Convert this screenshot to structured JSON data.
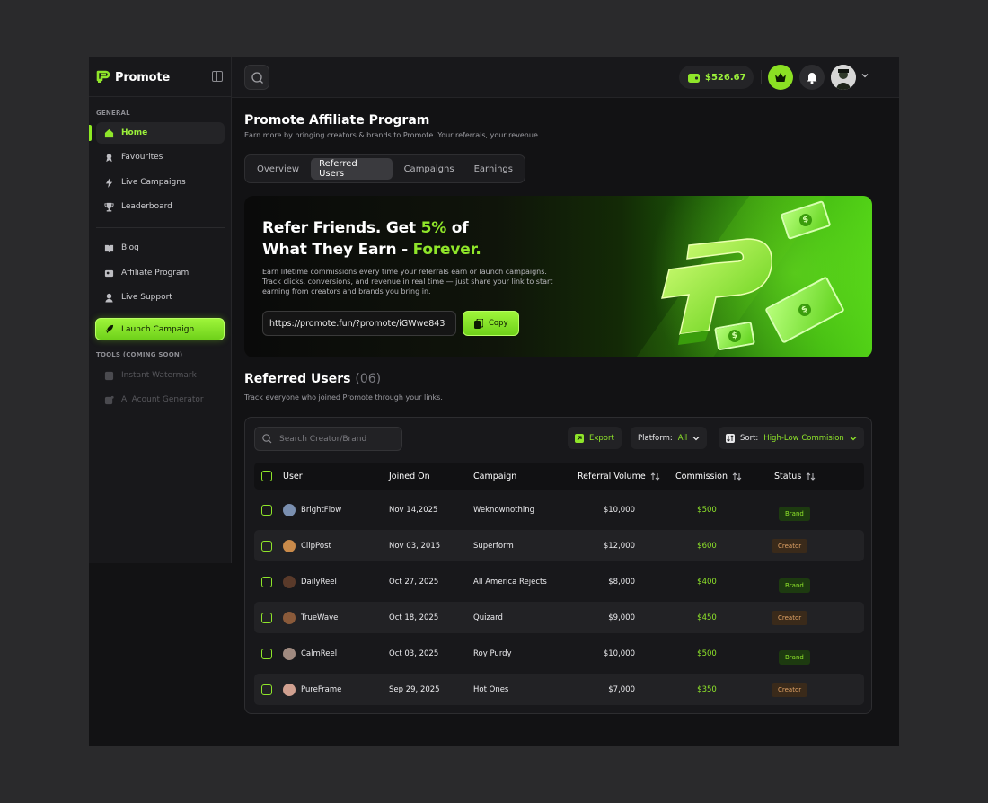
{
  "brand": {
    "name": "Promote"
  },
  "sidebar": {
    "general_label": "GENERAL",
    "items": [
      {
        "label": "Home",
        "icon": "home-icon",
        "active": true
      },
      {
        "label": "Favourites",
        "icon": "favourites-icon"
      },
      {
        "label": "Live Campaigns",
        "icon": "lightning-icon"
      },
      {
        "label": "Leaderboard",
        "icon": "trophy-icon"
      },
      {
        "label": "Blog",
        "icon": "book-icon"
      },
      {
        "label": "Affiliate Program",
        "icon": "affiliate-icon"
      },
      {
        "label": "Live Support",
        "icon": "support-icon"
      }
    ],
    "launch_label": "Launch Campaign",
    "tools_label": "TOOLS (COMING SOON)",
    "tools": [
      {
        "label": "Instant Watermark",
        "icon": "watermark-icon"
      },
      {
        "label": "AI Acount Generator",
        "icon": "ai-icon"
      }
    ]
  },
  "topbar": {
    "balance": "$526.67"
  },
  "page": {
    "title": "Promote Affiliate Program",
    "subtitle": "Earn more by bringing creators & brands to Promote. Your referrals, your revenue.",
    "tabs": [
      "Overview",
      "Referred Users",
      "Campaigns",
      "Earnings"
    ],
    "active_tab": "Referred Users"
  },
  "banner": {
    "title_line1_a": "Refer Friends. Get ",
    "title_line1_hl": "5%",
    "title_line1_b": " of",
    "title_line2_a": "What They Earn - ",
    "title_line2_hl": "Forever.",
    "description": "Earn lifetime commissions every time your referrals earn or launch campaigns. Track clicks, conversions, and revenue in real time — just share your link to start earning from creators and brands you bring in.",
    "link": "https://promote.fun/?promote/iGWwe843",
    "copy_label": "Copy"
  },
  "referred": {
    "title": "Referred Users",
    "count": "(06)",
    "subtitle": "Track everyone who joined Promote through your links.",
    "search_placeholder": "Search Creator/Brand",
    "export_label": "Export",
    "platform_label": "Platform:",
    "platform_value": "All",
    "sort_label": "Sort:",
    "sort_value": "High-Low Commision",
    "columns": [
      "User",
      "Joined On",
      "Campaign",
      "Referral Volume",
      "Commission",
      "Status"
    ],
    "rows": [
      {
        "user": "BrightFlow",
        "joined": "Nov 14,2025",
        "campaign": "Weknownothing",
        "volume": "$10,000",
        "commission": "$500",
        "status": "Brand",
        "avatar_color": "#7a8fb0"
      },
      {
        "user": "ClipPost",
        "joined": "Nov 03, 2015",
        "campaign": "Superform",
        "volume": "$12,000",
        "commission": "$600",
        "status": "Creator",
        "avatar_color": "#c98a4a"
      },
      {
        "user": "DailyReel",
        "joined": "Oct 27, 2025",
        "campaign": "All America Rejects",
        "volume": "$8,000",
        "commission": "$400",
        "status": "Brand",
        "avatar_color": "#5a3a2a"
      },
      {
        "user": "TrueWave",
        "joined": "Oct 18, 2025",
        "campaign": "Quizard",
        "volume": "$9,000",
        "commission": "$450",
        "status": "Creator",
        "avatar_color": "#8a5a3a"
      },
      {
        "user": "CalmReel",
        "joined": "Oct 03, 2025",
        "campaign": "Roy Purdy",
        "volume": "$10,000",
        "commission": "$500",
        "status": "Brand",
        "avatar_color": "#a08a80"
      },
      {
        "user": "PureFrame",
        "joined": "Sep 29, 2025",
        "campaign": "Hot Ones",
        "volume": "$7,000",
        "commission": "$350",
        "status": "Creator",
        "avatar_color": "#d0a090"
      }
    ]
  },
  "colors": {
    "accent": "#8fe52a",
    "background": "#121214",
    "panel": "#18181b",
    "creator": "#e0a265"
  }
}
